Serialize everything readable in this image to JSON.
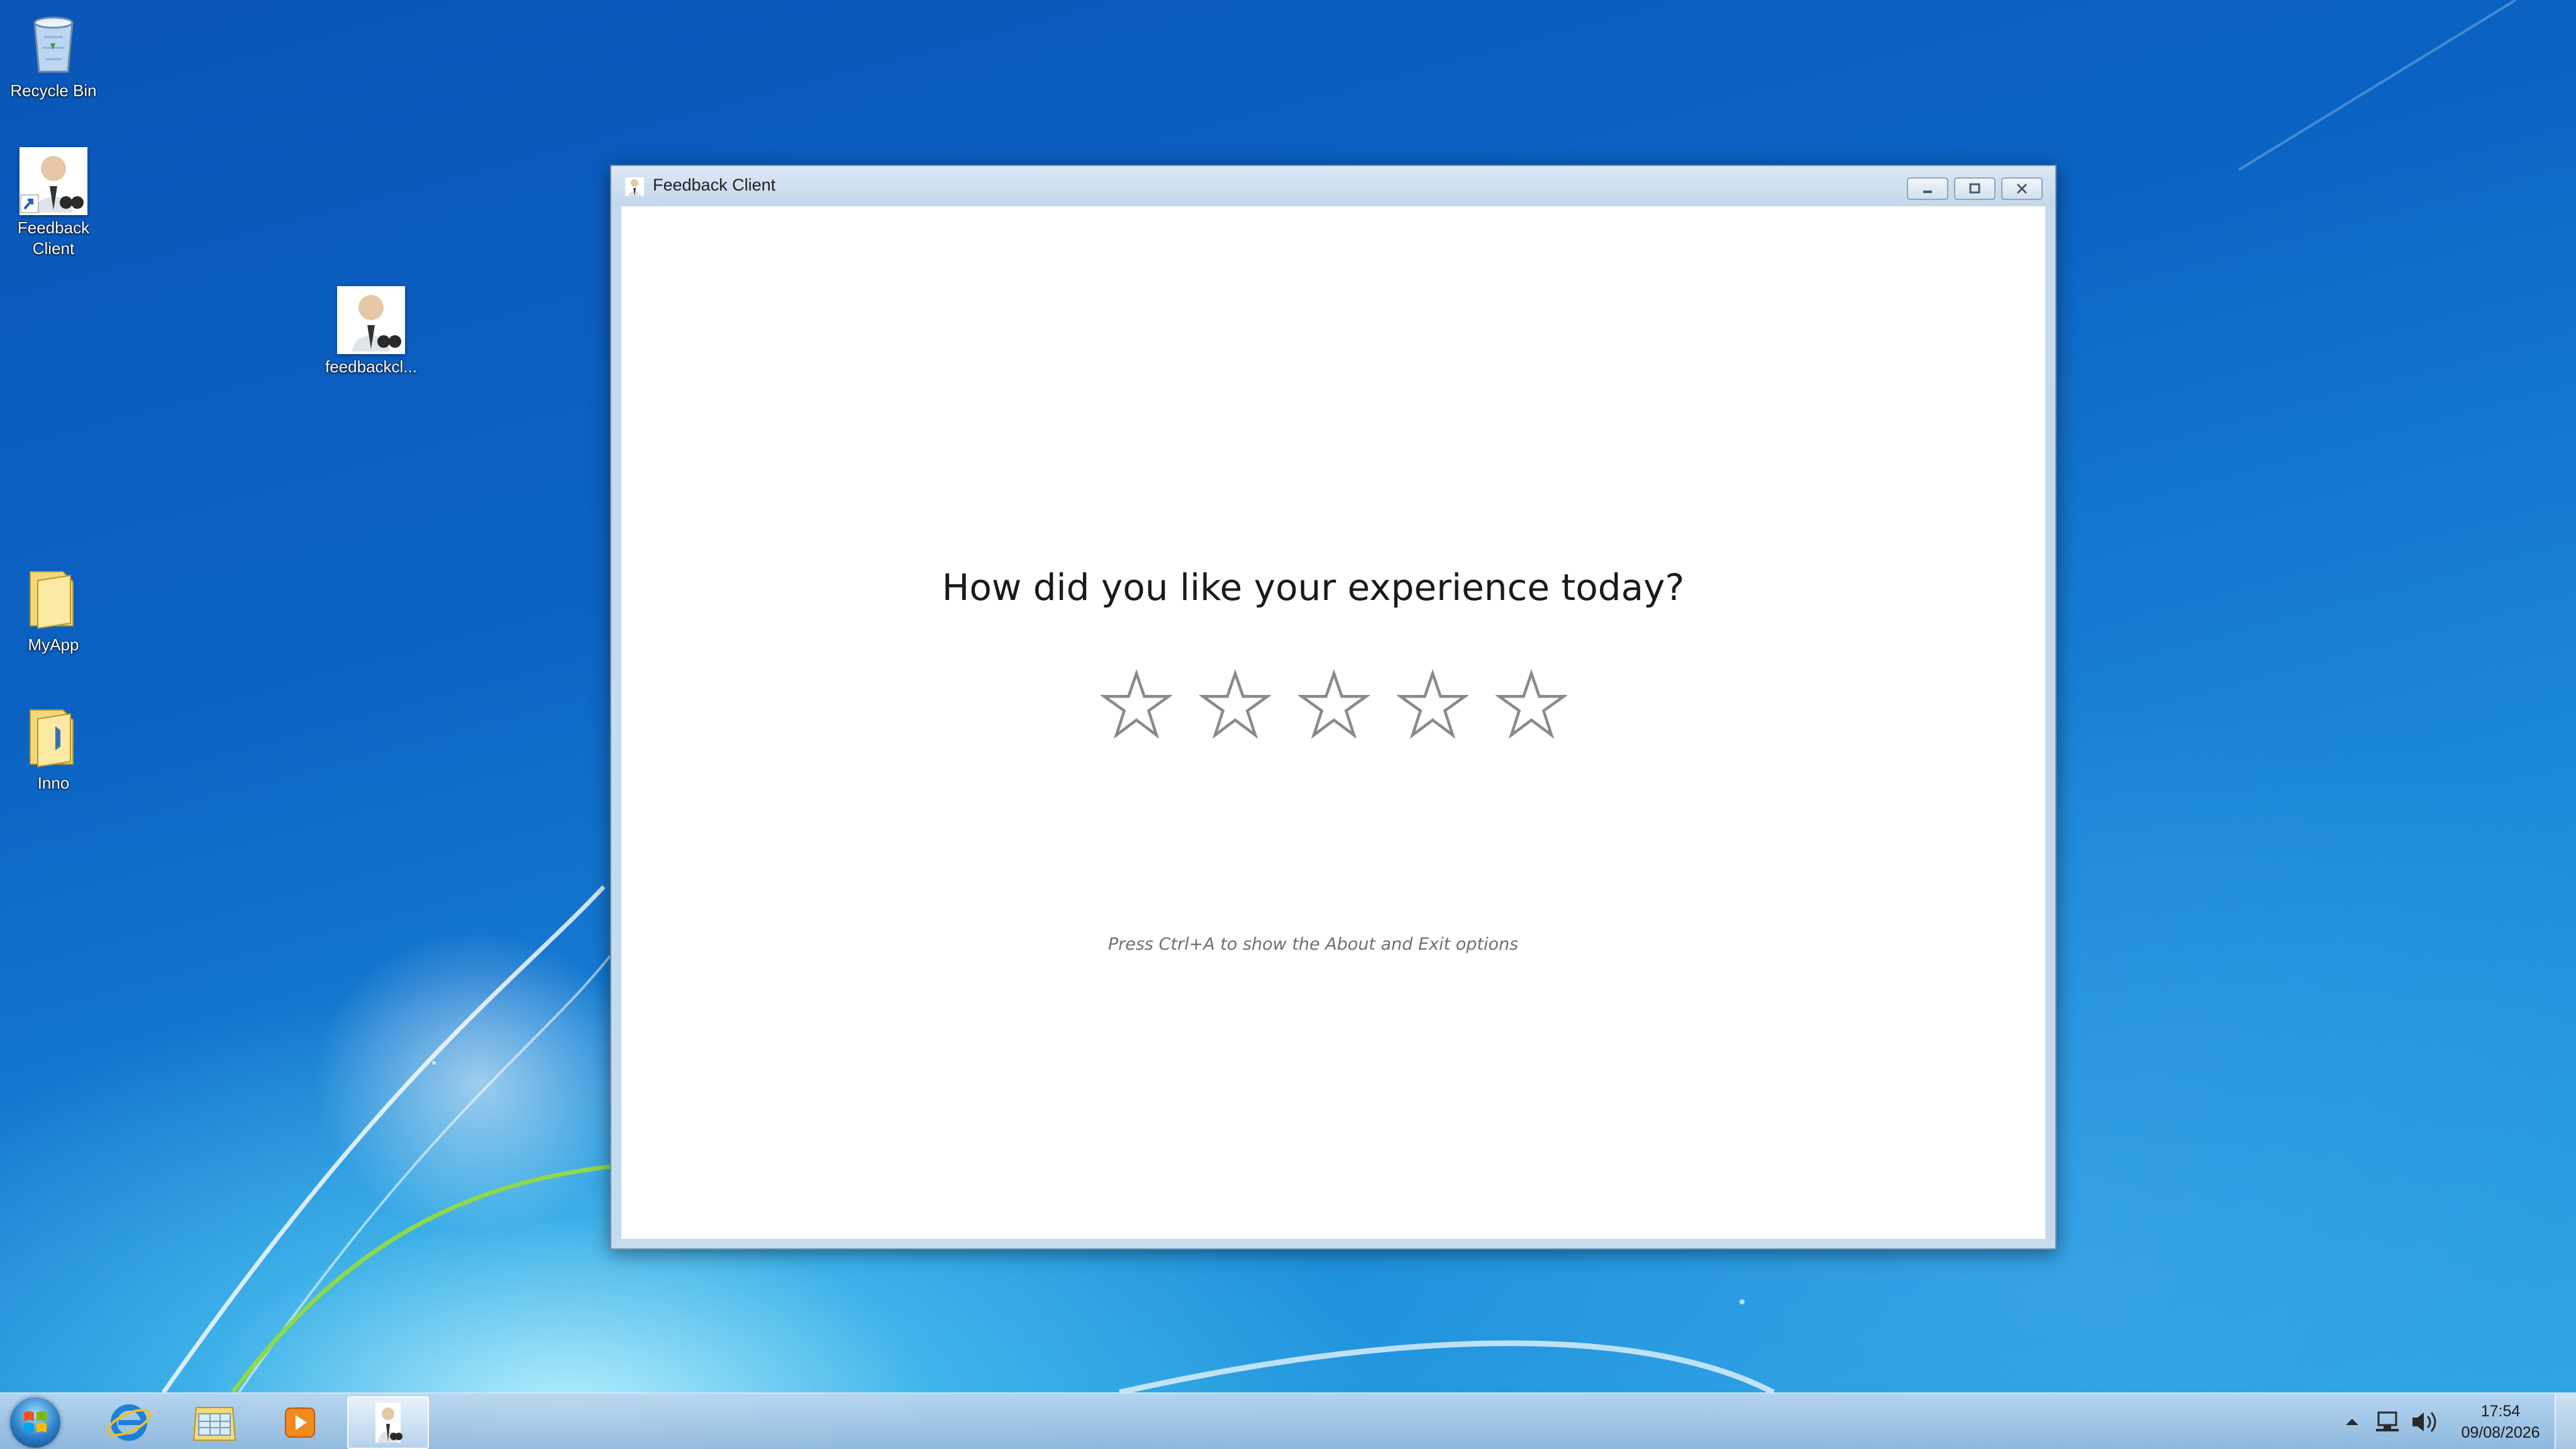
{
  "desktop": {
    "icons": [
      {
        "label": "Recycle Bin",
        "icon": "recycle-bin-icon"
      },
      {
        "label": "Feedback\nClient",
        "icon": "feedback-client-shortcut-icon"
      },
      {
        "label": "feedbackcl...",
        "icon": "feedback-client-file-icon"
      },
      {
        "label": "MyApp",
        "icon": "folder-icon"
      },
      {
        "label": "Inno",
        "icon": "folder-icon"
      }
    ]
  },
  "window": {
    "title": "Feedback Client",
    "question": "How did you like your experience today?",
    "rating": {
      "max": 5,
      "selected": 0
    },
    "hint": "Press Ctrl+A to show the About and Exit options"
  },
  "taskbar": {
    "pinned": [
      "internet-explorer-icon",
      "windows-explorer-icon",
      "media-player-icon",
      "feedback-client-icon"
    ],
    "clock": {
      "time": "17:54",
      "date": "09/08/2026"
    }
  },
  "colors": {
    "desktop_top": "#0a55b8",
    "window_frame": "#c6daee",
    "star_outline": "#8a8a8a",
    "question_text": "#1a1a1a",
    "hint_text": "#707070"
  }
}
